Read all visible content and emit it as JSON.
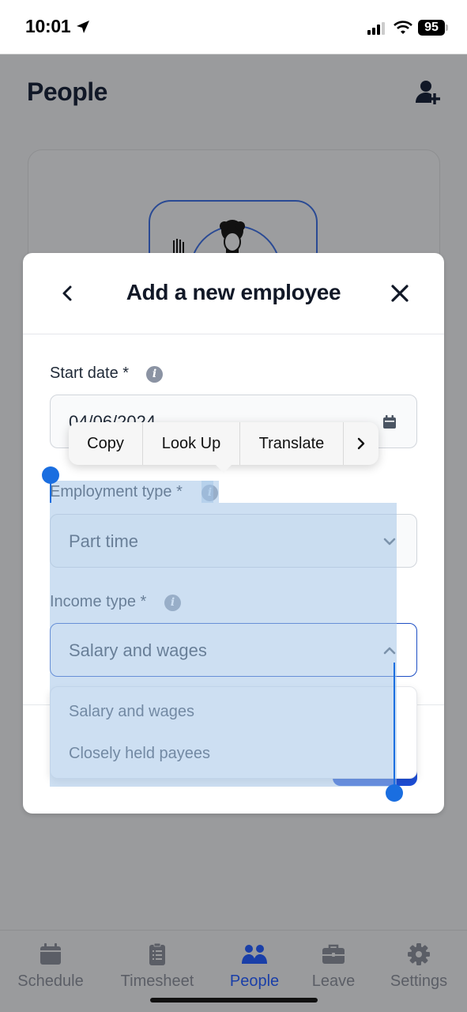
{
  "status_bar": {
    "time": "10:01",
    "battery": "95"
  },
  "app": {
    "title": "People"
  },
  "modal": {
    "title": "Add a new employee",
    "fields": {
      "start_date": {
        "label": "Start date *",
        "value": "04/06/2024"
      },
      "employment_type": {
        "label": "Employment type *",
        "value": "Part time"
      },
      "income_type": {
        "label": "Income type *",
        "value": "Salary and wages",
        "options": [
          "Salary and wages",
          "Closely held payees"
        ]
      }
    }
  },
  "context_menu": {
    "items": [
      "Copy",
      "Look Up",
      "Translate"
    ]
  },
  "tabbar": {
    "items": [
      {
        "label": "Schedule",
        "icon": "calendar-icon"
      },
      {
        "label": "Timesheet",
        "icon": "clipboard-icon"
      },
      {
        "label": "People",
        "icon": "people-icon",
        "active": true
      },
      {
        "label": "Leave",
        "icon": "briefcase-icon"
      },
      {
        "label": "Settings",
        "icon": "gear-icon"
      }
    ]
  },
  "colors": {
    "accent": "#1d4ed8",
    "active_tab": "#1a3fa8",
    "selection": "#a4c4e8",
    "selection_handle": "#1a6ee0",
    "overlay": "#9a9b9d"
  }
}
